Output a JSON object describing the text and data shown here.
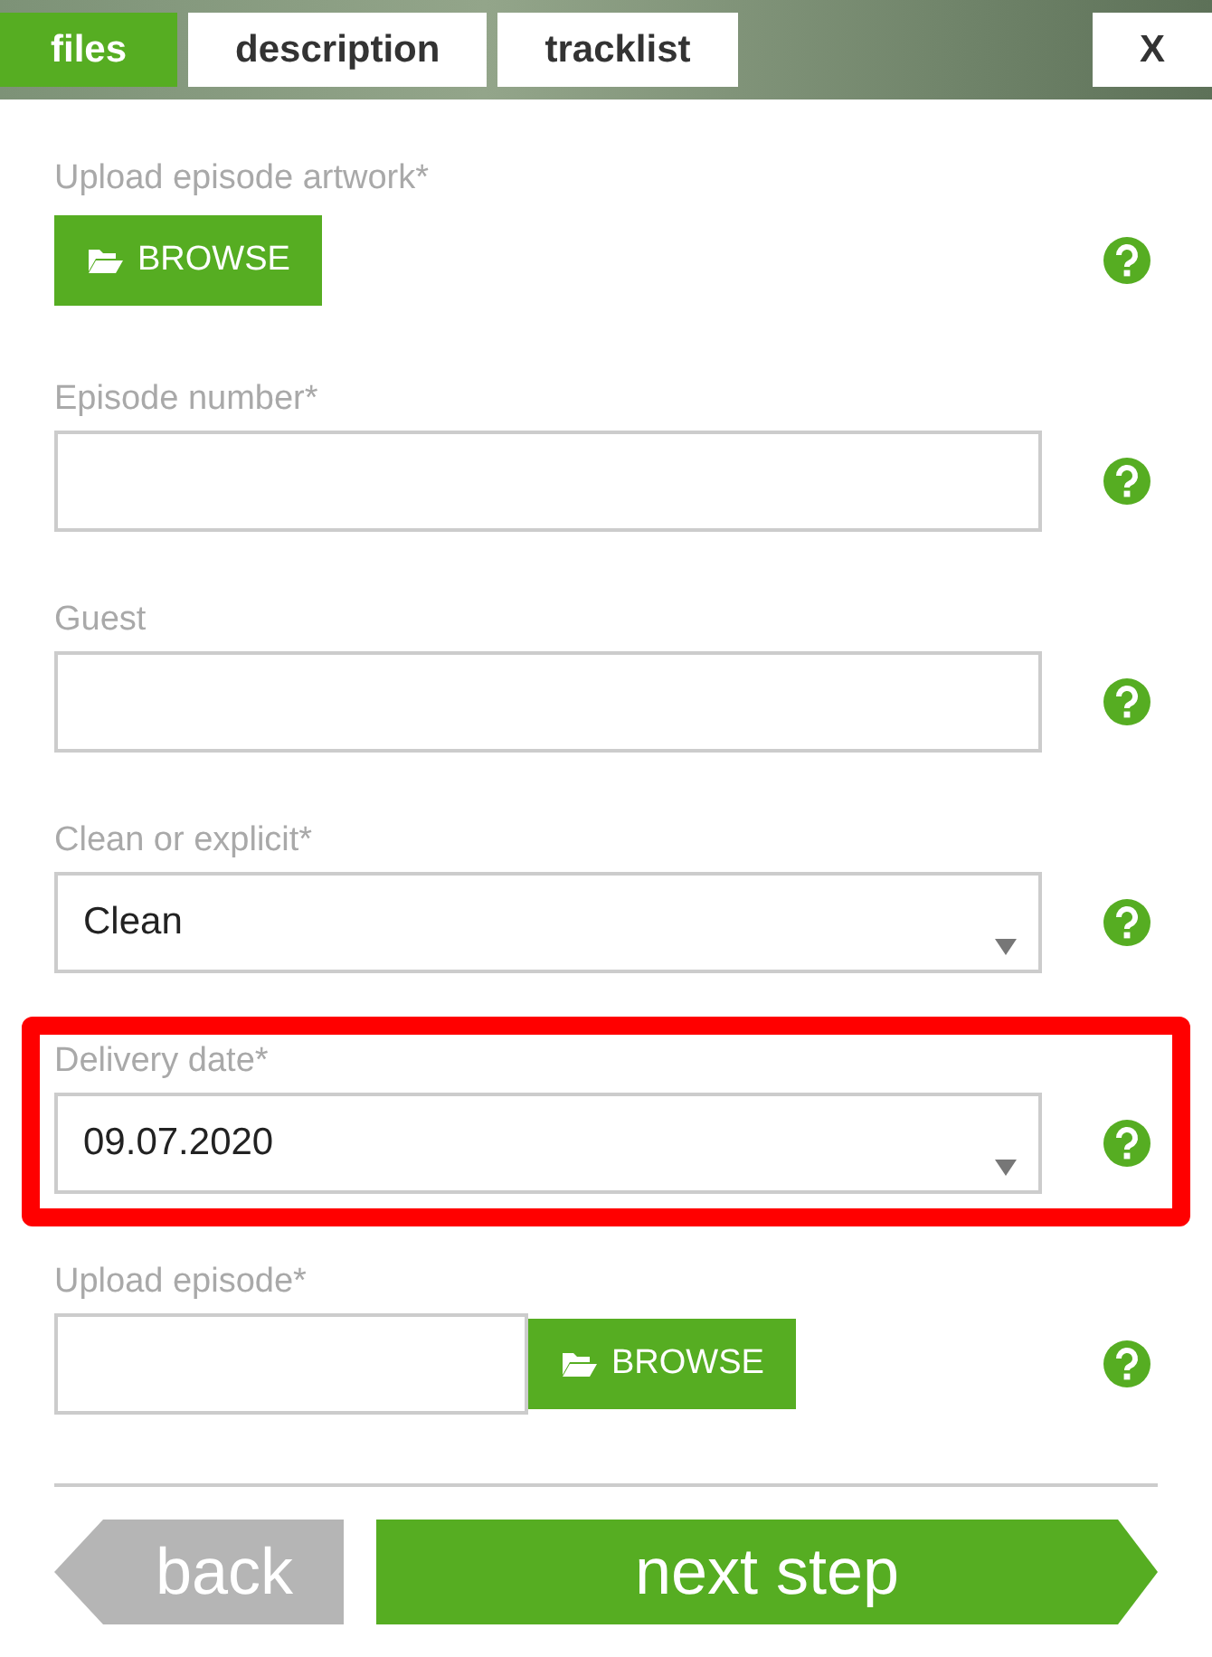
{
  "tabs": [
    {
      "label": "files",
      "selected": true
    },
    {
      "label": "description",
      "selected": false
    },
    {
      "label": "tracklist",
      "selected": false
    }
  ],
  "close_label": "X",
  "fields": [
    {
      "kind": "browse",
      "label": "Upload episode artwork*",
      "button": "BROWSE",
      "highlighted": false
    },
    {
      "kind": "text",
      "label": "Episode number*",
      "highlighted": false
    },
    {
      "kind": "text",
      "label": "Guest",
      "highlighted": false
    },
    {
      "kind": "select",
      "label": "Clean or explicit*",
      "value": "Clean",
      "highlighted": false
    },
    {
      "kind": "select",
      "label": "Delivery date*",
      "value": "09.07.2020",
      "highlighted": true
    },
    {
      "kind": "upload",
      "label": "Upload episode*",
      "button": "BROWSE",
      "highlighted": false
    }
  ],
  "back_button": "back",
  "next_button": "next step"
}
